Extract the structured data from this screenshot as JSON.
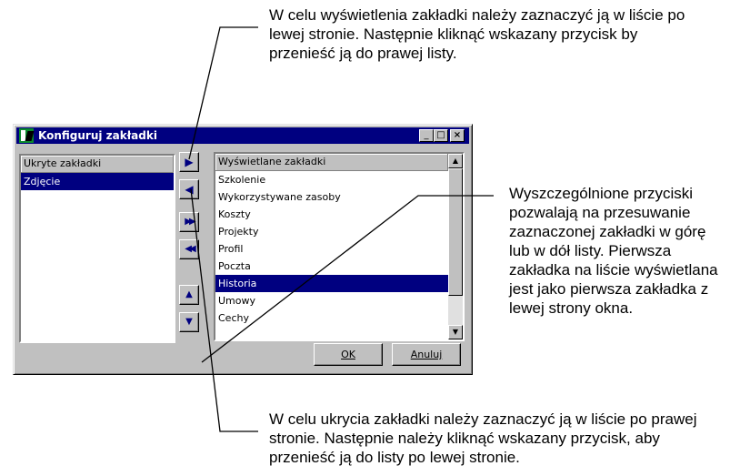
{
  "callouts": {
    "top": "W celu wyświetlenia zakładki należy zaznaczyć ją w liście po lewej stronie. Następnie kliknąć wskazany przycisk by przenieść ją do prawej listy.",
    "right": "Wyszczególnione przyciski pozwalają na przesuwanie zaznaczonej zakładki w górę lub w dół listy. Pierwsza zakładka na liście wyświetlana jest jako pierwsza zakładka z lewej strony okna.",
    "bottom": "W celu ukrycia zakładki należy zaznaczyć ją w liście po prawej stronie. Następnie należy kliknąć wskazany przycisk, aby przenieść ją do listy po lewej stronie."
  },
  "dialog": {
    "title": "Konfiguruj zakładki",
    "titlebar_buttons": {
      "minimize": "_",
      "maximize": "□",
      "close": "×"
    },
    "hidden_list": {
      "header": "Ukryte zakładki",
      "items": [
        "Zdjęcie"
      ],
      "selected": "Zdjęcie"
    },
    "shown_list": {
      "header": "Wyświetlane zakładki",
      "items": [
        "Szkolenie",
        "Wykorzystywane zasoby",
        "Koszty",
        "Projekty",
        "Profil",
        "Poczta",
        "Historia",
        "Umowy",
        "Cechy"
      ],
      "selected": "Historia"
    },
    "move_buttons": {
      "move_right": "▶",
      "move_left": "◀",
      "move_all_right": "▶▶",
      "move_all_left": "◀◀",
      "move_up": "▲",
      "move_down": "▼"
    },
    "ok_label": "OK",
    "cancel_label": "Anuluj",
    "colors": {
      "face": "#c0c0c0",
      "title": "#000080",
      "selection": "#000080"
    }
  }
}
